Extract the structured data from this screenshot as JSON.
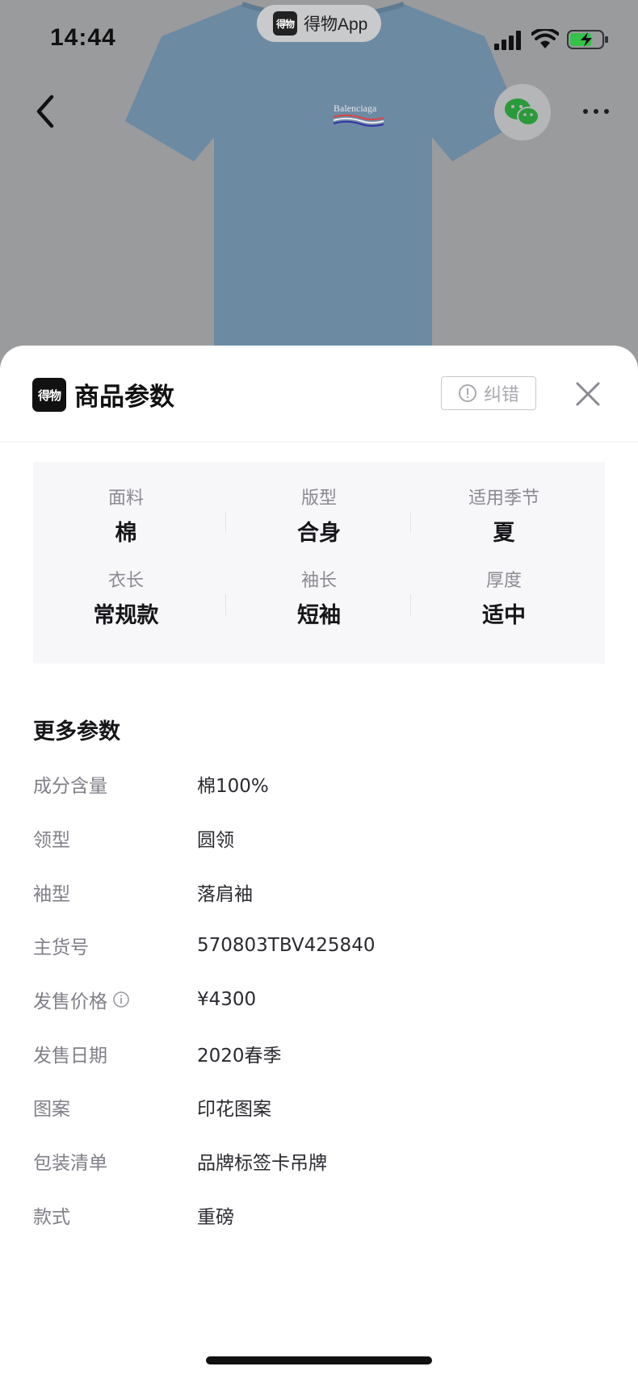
{
  "status_bar": {
    "time": "14:44",
    "app_name": "得物App",
    "app_logo_text": "得物"
  },
  "nav": {
    "back_icon": "chevron-left-icon",
    "share_icon": "wechat-icon",
    "more_icon": "more-dots-icon"
  },
  "sheet": {
    "logo_text": "得物",
    "title": "商品参数",
    "report_label": "纠错",
    "close_icon": "close-icon"
  },
  "key_params": [
    {
      "label": "面料",
      "value": "棉"
    },
    {
      "label": "版型",
      "value": "合身"
    },
    {
      "label": "适用季节",
      "value": "夏"
    },
    {
      "label": "衣长",
      "value": "常规款"
    },
    {
      "label": "袖长",
      "value": "短袖"
    },
    {
      "label": "厚度",
      "value": "适中"
    }
  ],
  "more_params": {
    "title": "更多参数",
    "rows": [
      {
        "label": "成分含量",
        "value": "棉100%"
      },
      {
        "label": "领型",
        "value": "圆领"
      },
      {
        "label": "袖型",
        "value": "落肩袖"
      },
      {
        "label": "主货号",
        "value": "570803TBV425840"
      },
      {
        "label": "发售价格",
        "value": "¥4300",
        "has_info": true
      },
      {
        "label": "发售日期",
        "value": "2020春季"
      },
      {
        "label": "图案",
        "value": "印花图案"
      },
      {
        "label": "包装清单",
        "value": "品牌标签卡吊牌"
      },
      {
        "label": "款式",
        "value": "重磅"
      }
    ]
  },
  "colors": {
    "shirt": "#6f8ea8",
    "dimmed_bg": "#9a9b9d",
    "label_gray": "#8a8a92",
    "panel_bg": "#f7f7f9"
  }
}
